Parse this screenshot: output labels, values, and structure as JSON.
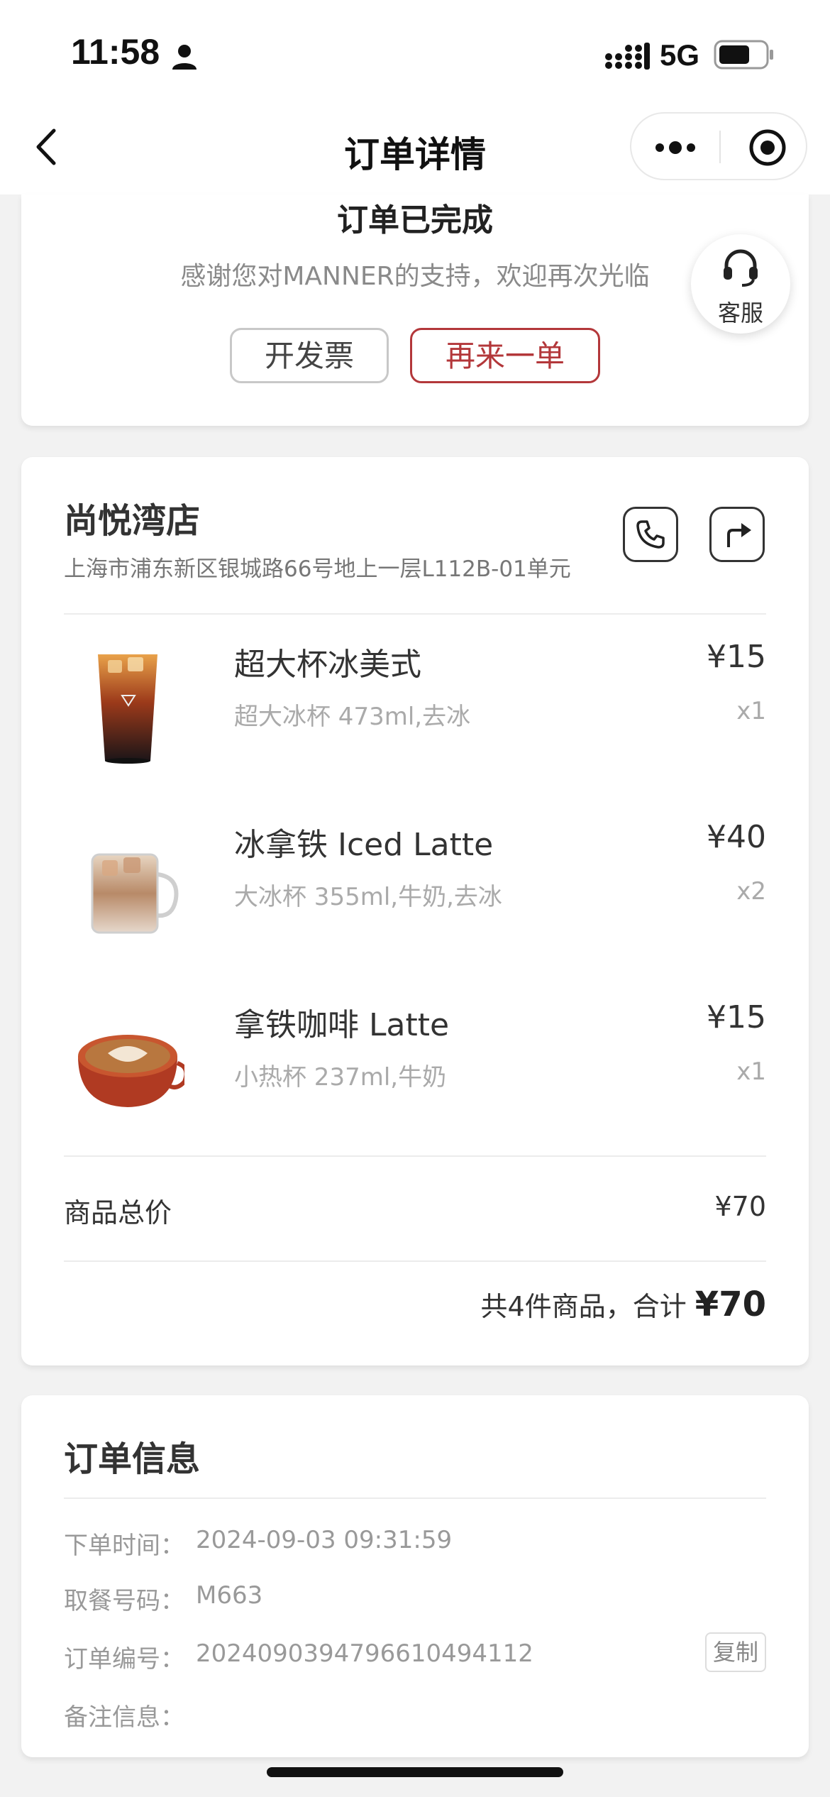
{
  "status_bar": {
    "time": "11:58",
    "network": "5G",
    "icons": [
      "person-icon",
      "signal-icon",
      "battery-icon"
    ]
  },
  "nav": {
    "title": "订单详情",
    "icons": [
      "back-icon",
      "more-icon",
      "target-icon"
    ]
  },
  "order_status": {
    "title": "订单已完成",
    "subtitle": "感谢您对MANNER的支持，欢迎再次光临",
    "invoice_button": "开发票",
    "reorder_button": "再来一单",
    "accent_color": "#b3373a"
  },
  "customer_service": {
    "label": "客服",
    "icon": "headset-icon"
  },
  "store": {
    "name": "尚悦湾店",
    "address": "上海市浦东新区银城路66号地上一层L112B-01单元",
    "icons": [
      "phone-icon",
      "navigation-icon"
    ]
  },
  "items": [
    {
      "name": "超大杯冰美式",
      "spec": "超大冰杯 473ml,去冰",
      "price": "¥15",
      "qty": "x1",
      "thumb": "iced-americano-icon"
    },
    {
      "name": "冰拿铁 Iced Latte",
      "spec": "大冰杯 355ml,牛奶,去冰",
      "price": "¥40",
      "qty": "x2",
      "thumb": "iced-latte-icon"
    },
    {
      "name": "拿铁咖啡 Latte",
      "spec": "小热杯 237ml,牛奶",
      "price": "¥15",
      "qty": "x1",
      "thumb": "hot-latte-icon"
    }
  ],
  "summary": {
    "subtotal_label": "商品总价",
    "subtotal_value": "¥70",
    "total_prefix": "共4件商品，合计",
    "total_amount": "¥70"
  },
  "order_info": {
    "title": "订单信息",
    "rows": [
      {
        "label": "下单时间：",
        "value": "2024-09-03 09:31:59"
      },
      {
        "label": "取餐号码：",
        "value": "M663"
      },
      {
        "label": "订单编号：",
        "value": "2024090394796610494112"
      },
      {
        "label": "备注信息：",
        "value": ""
      }
    ],
    "copy_button": "复制"
  }
}
